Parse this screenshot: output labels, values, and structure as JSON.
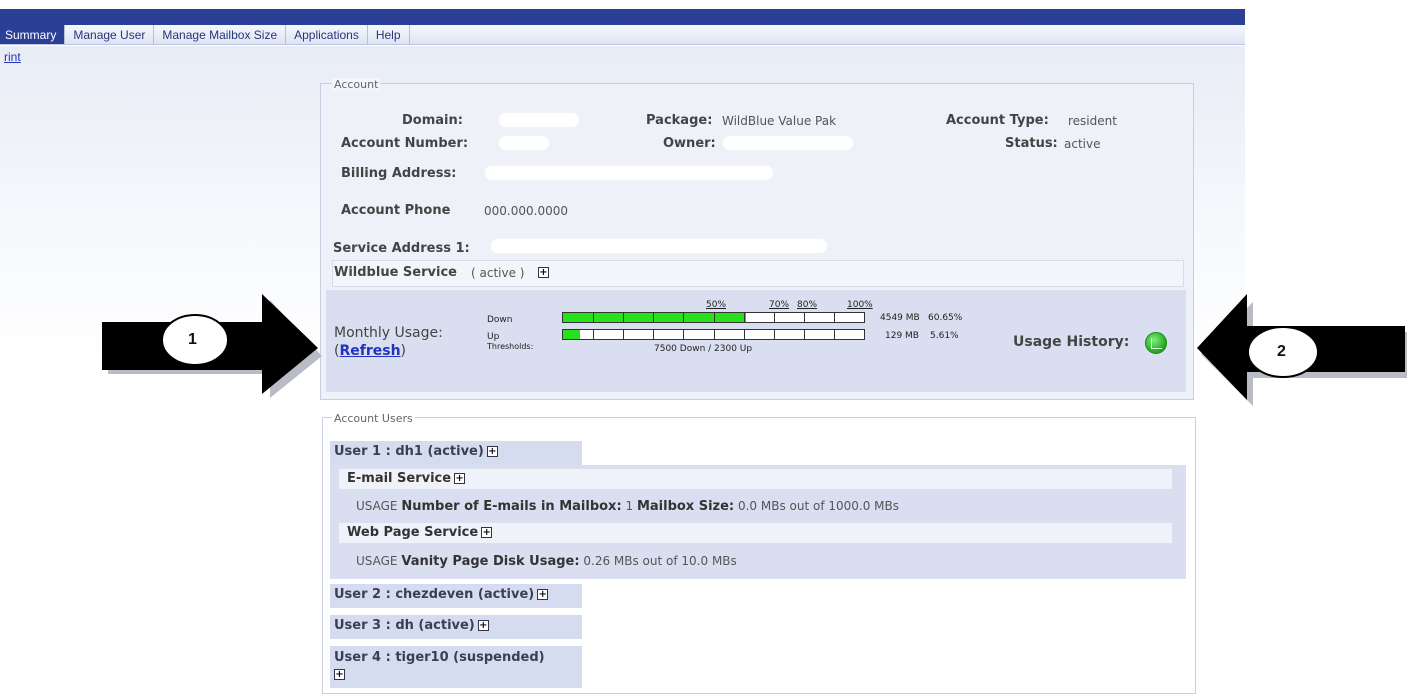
{
  "nav": {
    "tabs": [
      "Summary",
      "Manage User",
      "Manage Mailbox Size",
      "Applications",
      "Help"
    ],
    "active_tab": "Summary",
    "print_link": "rint"
  },
  "account": {
    "legend": "Account",
    "domain_label": "Domain:",
    "package_label": "Package:",
    "package_value": "WildBlue Value Pak",
    "account_type_label": "Account Type:",
    "account_type_value": "resident",
    "account_number_label": "Account Number:",
    "owner_label": "Owner:",
    "status_label": "Status:",
    "status_value": "active",
    "billing_address_label": "Billing Address:",
    "account_phone_label": "Account Phone",
    "account_phone_value": "000.000.0000",
    "service_address_label": "Service Address 1:",
    "wildblue_service_label": "Wildblue Service",
    "wildblue_service_status": "( active )"
  },
  "usage": {
    "monthly_label": "Monthly Usage:",
    "refresh_open": "(",
    "refresh_link": "Refresh",
    "refresh_close": ")",
    "down_label": "Down",
    "up_label": "Up",
    "thresholds_label": "Thresholds:",
    "thresholds_value": "7500 Down / 2300 Up",
    "pct_50": "50%",
    "pct_70": "70%",
    "pct_80": "80%",
    "pct_100": "100%",
    "down_amount": "4549 MB",
    "down_percent": "60.65%",
    "down_fraction": 0.6065,
    "up_amount": "129 MB",
    "up_percent": "5.61%",
    "up_fraction": 0.0561,
    "history_label": "Usage History:"
  },
  "callouts": {
    "left_number": "1",
    "right_number": "2"
  },
  "users": {
    "legend": "Account Users",
    "user1": "User 1 : dh1 (active)",
    "email_service": "E-mail Service",
    "usage_tag": "USAGE",
    "emails_label": "Number of E-mails in Mailbox:",
    "emails_value": "1",
    "mailbox_label": "Mailbox Size:",
    "mailbox_value": "0.0 MBs out of 1000.0 MBs",
    "web_service": "Web Page Service",
    "vanity_label": "Vanity Page Disk Usage:",
    "vanity_value": "0.26 MBs out of 10.0 MBs",
    "user2": "User 2 : chezdeven (active)",
    "user3": "User 3 : dh (active)",
    "user4": "User 4 : tiger10 (suspended)"
  },
  "colors": {
    "nav_blue": "#2b3f96",
    "bar_green": "#27e11c",
    "panel_bg": "#eef1f8"
  }
}
